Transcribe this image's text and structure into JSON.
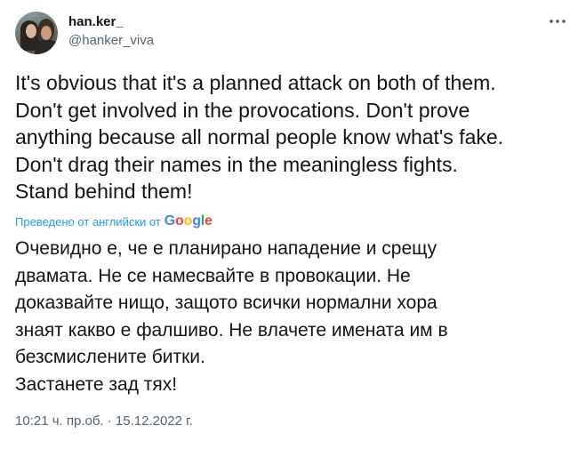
{
  "author": {
    "display_name": "han.ker_",
    "handle": "@hanker_viva"
  },
  "tweet": {
    "text": "It's obvious that it's a planned attack on both of them.\nDon't get involved in the provocations. Don't prove\nanything because all normal people know what's fake.\nDon't drag their names in the meaningless fights.\nStand behind them!"
  },
  "translation": {
    "note": "Преведено от английски от",
    "provider": "Google",
    "text": "Очевидно е, че е планирано нападение и срещу\nдвамата. Не се намесвайте в провокации. Не\nдоказвайте нищо, защото всички нормални хора\nзнаят какво е фалшиво. Не влачете имената им в\nбезсмислените битки.\nЗастанете зад тях!"
  },
  "meta": {
    "timestamp": "10:21 ч. пр.об. · 15.12.2022 г."
  },
  "icons": {
    "more": "more-horizontal-icon"
  },
  "colors": {
    "text": "#0f1419",
    "secondary": "#536471",
    "link": "#1d9bf0"
  }
}
